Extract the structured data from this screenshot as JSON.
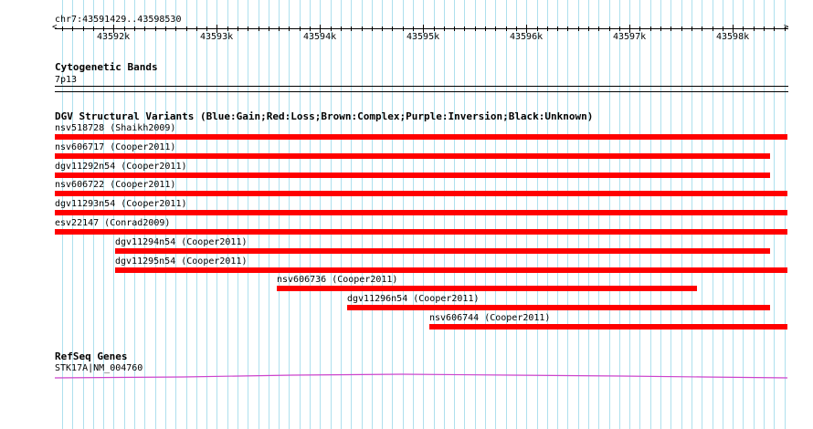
{
  "ruler": {
    "location": "chr7:43591429..43598530",
    "start": 43591429,
    "end": 43598530,
    "labels": [
      {
        "pos": 43592000,
        "text": "43592k"
      },
      {
        "pos": 43593000,
        "text": "43593k"
      },
      {
        "pos": 43594000,
        "text": "43594k"
      },
      {
        "pos": 43595000,
        "text": "43595k"
      },
      {
        "pos": 43596000,
        "text": "43596k"
      },
      {
        "pos": 43597000,
        "text": "43597k"
      },
      {
        "pos": 43598000,
        "text": "43598k"
      }
    ]
  },
  "cytoband": {
    "title": "Cytogenetic Bands",
    "band": "7p13"
  },
  "dgv": {
    "title": "DGV Structural Variants (Blue:Gain;Red:Loss;Brown:Complex;Purple:Inversion;Black:Unknown)",
    "color": "#ff0000",
    "variants": [
      {
        "label": "nsv518728 (Shaikh2009)",
        "start": 43591429,
        "end": 43598530
      },
      {
        "label": "nsv606717 (Cooper2011)",
        "start": 43591429,
        "end": 43598360
      },
      {
        "label": "dgv11292n54 (Cooper2011)",
        "start": 43591429,
        "end": 43598360
      },
      {
        "label": "nsv606722 (Cooper2011)",
        "start": 43591429,
        "end": 43598530
      },
      {
        "label": "dgv11293n54 (Cooper2011)",
        "start": 43591429,
        "end": 43598530
      },
      {
        "label": "esv22147 (Conrad2009)",
        "start": 43591429,
        "end": 43598530
      },
      {
        "label": "dgv11294n54 (Cooper2011)",
        "start": 43592010,
        "end": 43598360
      },
      {
        "label": "dgv11295n54 (Cooper2011)",
        "start": 43592010,
        "end": 43598530
      },
      {
        "label": "nsv606736 (Cooper2011)",
        "start": 43593580,
        "end": 43597650
      },
      {
        "label": "dgv11296n54 (Cooper2011)",
        "start": 43594260,
        "end": 43598360
      },
      {
        "label": "nsv606744 (Cooper2011)",
        "start": 43595060,
        "end": 43598530
      }
    ]
  },
  "refseq": {
    "title": "RefSeq Genes",
    "gene": "STK17A|NM_004760",
    "color": "#cc44cc"
  }
}
